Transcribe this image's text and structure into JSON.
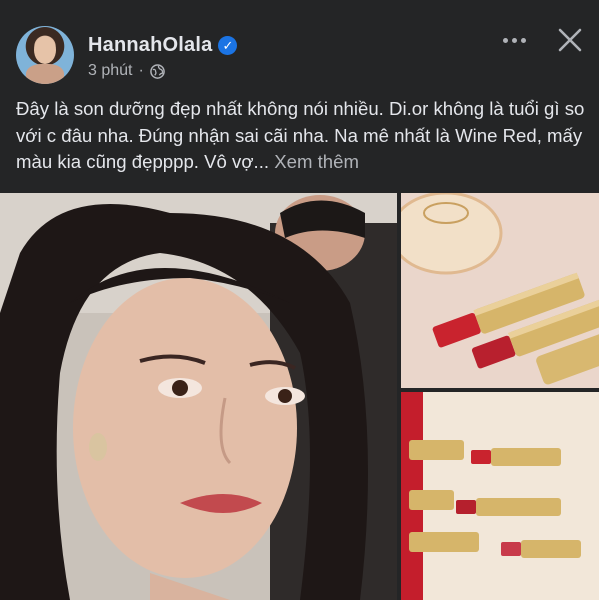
{
  "post": {
    "author": "HannahOlala",
    "verified_icon": "verified-badge-icon",
    "time": "3 phút",
    "privacy_icon": "globe-icon",
    "text": "Đây là son dưỡng đẹp nhất không nói nhiều. Di.or không là tuổi gì so với c đâu nha. Đúng nhận sai cãi nha. Na mê nhất là Wine Red, mấy màu kia cũng đẹpppp. Vô vợ...",
    "see_more": "Xem thêm",
    "actions": {
      "more_icon": "more-horizontal-icon",
      "close_icon": "close-icon"
    }
  },
  "colors": {
    "background": "#242526",
    "text_primary": "#e4e6eb",
    "text_secondary": "#b0b3b8",
    "verified_blue": "#1b74e4"
  },
  "photos": [
    {
      "name": "selfie-photo"
    },
    {
      "name": "lipstick-product-photo"
    },
    {
      "name": "lipstick-flatlay-photo"
    }
  ]
}
